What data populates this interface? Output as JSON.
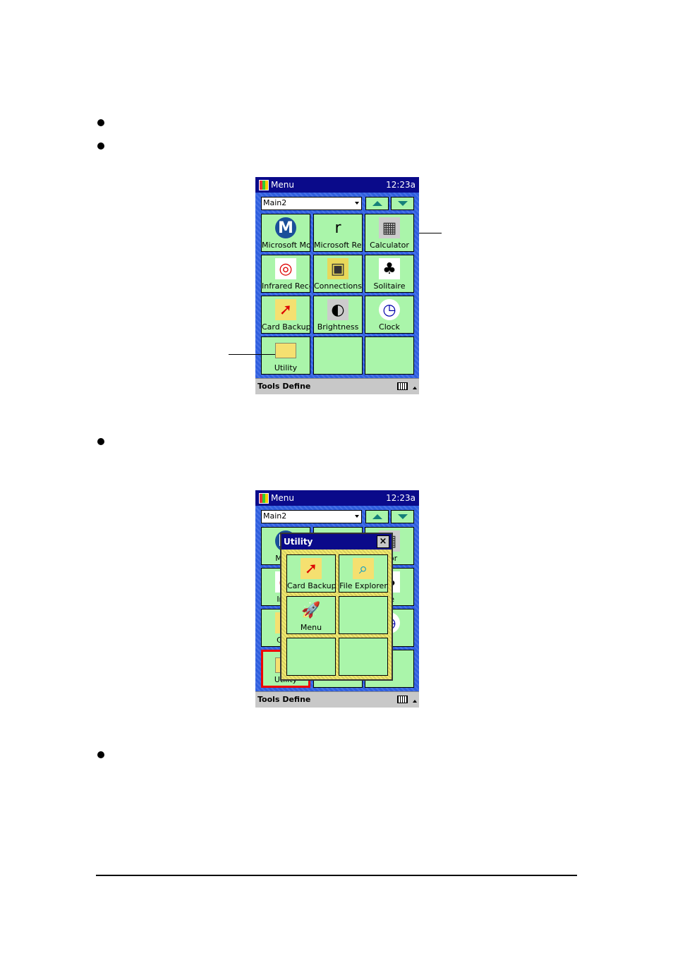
{
  "screens": [
    {
      "title": "Menu",
      "time": "12:23a",
      "dropdown": "Main2",
      "items": [
        {
          "label": "Microsoft Mo",
          "icon": "money-icon"
        },
        {
          "label": "Microsoft Rea",
          "icon": "reader-icon"
        },
        {
          "label": "Calculator",
          "icon": "calculator-icon"
        },
        {
          "label": "Infrared Rece",
          "icon": "infrared-icon"
        },
        {
          "label": "Connections",
          "icon": "connections-icon"
        },
        {
          "label": "Solitaire",
          "icon": "solitaire-icon"
        },
        {
          "label": "Card Backup",
          "icon": "card-backup-icon"
        },
        {
          "label": "Brightness",
          "icon": "brightness-icon"
        },
        {
          "label": "Clock",
          "icon": "clock-icon"
        },
        {
          "label": "Utility",
          "icon": "folder-icon"
        },
        {
          "label": "",
          "icon": ""
        },
        {
          "label": "",
          "icon": ""
        }
      ],
      "menu_bar": {
        "tools": "Tools",
        "define": "Define"
      }
    },
    {
      "title": "Menu",
      "time": "12:23a",
      "dropdown": "Main2",
      "items": [
        {
          "label": "Micro",
          "icon": "money-icon"
        },
        {
          "label": "",
          "icon": "reader-icon"
        },
        {
          "label": "ator",
          "icon": "calculator-icon"
        },
        {
          "label": "Infra",
          "icon": "infrared-icon"
        },
        {
          "label": "",
          "icon": "connections-icon"
        },
        {
          "label": "ire",
          "icon": "solitaire-icon"
        },
        {
          "label": "Card",
          "icon": "card-backup-icon"
        },
        {
          "label": "",
          "icon": "brightness-icon"
        },
        {
          "label": "k",
          "icon": "clock-icon"
        },
        {
          "label": "Utility",
          "icon": "folder-icon"
        },
        {
          "label": "",
          "icon": ""
        },
        {
          "label": "",
          "icon": ""
        }
      ],
      "popup": {
        "title": "Utility",
        "close": "×",
        "items": [
          {
            "label": "Card Backup",
            "icon": "card-backup-icon"
          },
          {
            "label": "File Explorer",
            "icon": "file-explorer-icon"
          },
          {
            "label": "Menu",
            "icon": "rocket-icon"
          },
          {
            "label": "",
            "icon": ""
          },
          {
            "label": "",
            "icon": ""
          },
          {
            "label": "",
            "icon": ""
          }
        ]
      },
      "menu_bar": {
        "tools": "Tools",
        "define": "Define"
      }
    }
  ]
}
